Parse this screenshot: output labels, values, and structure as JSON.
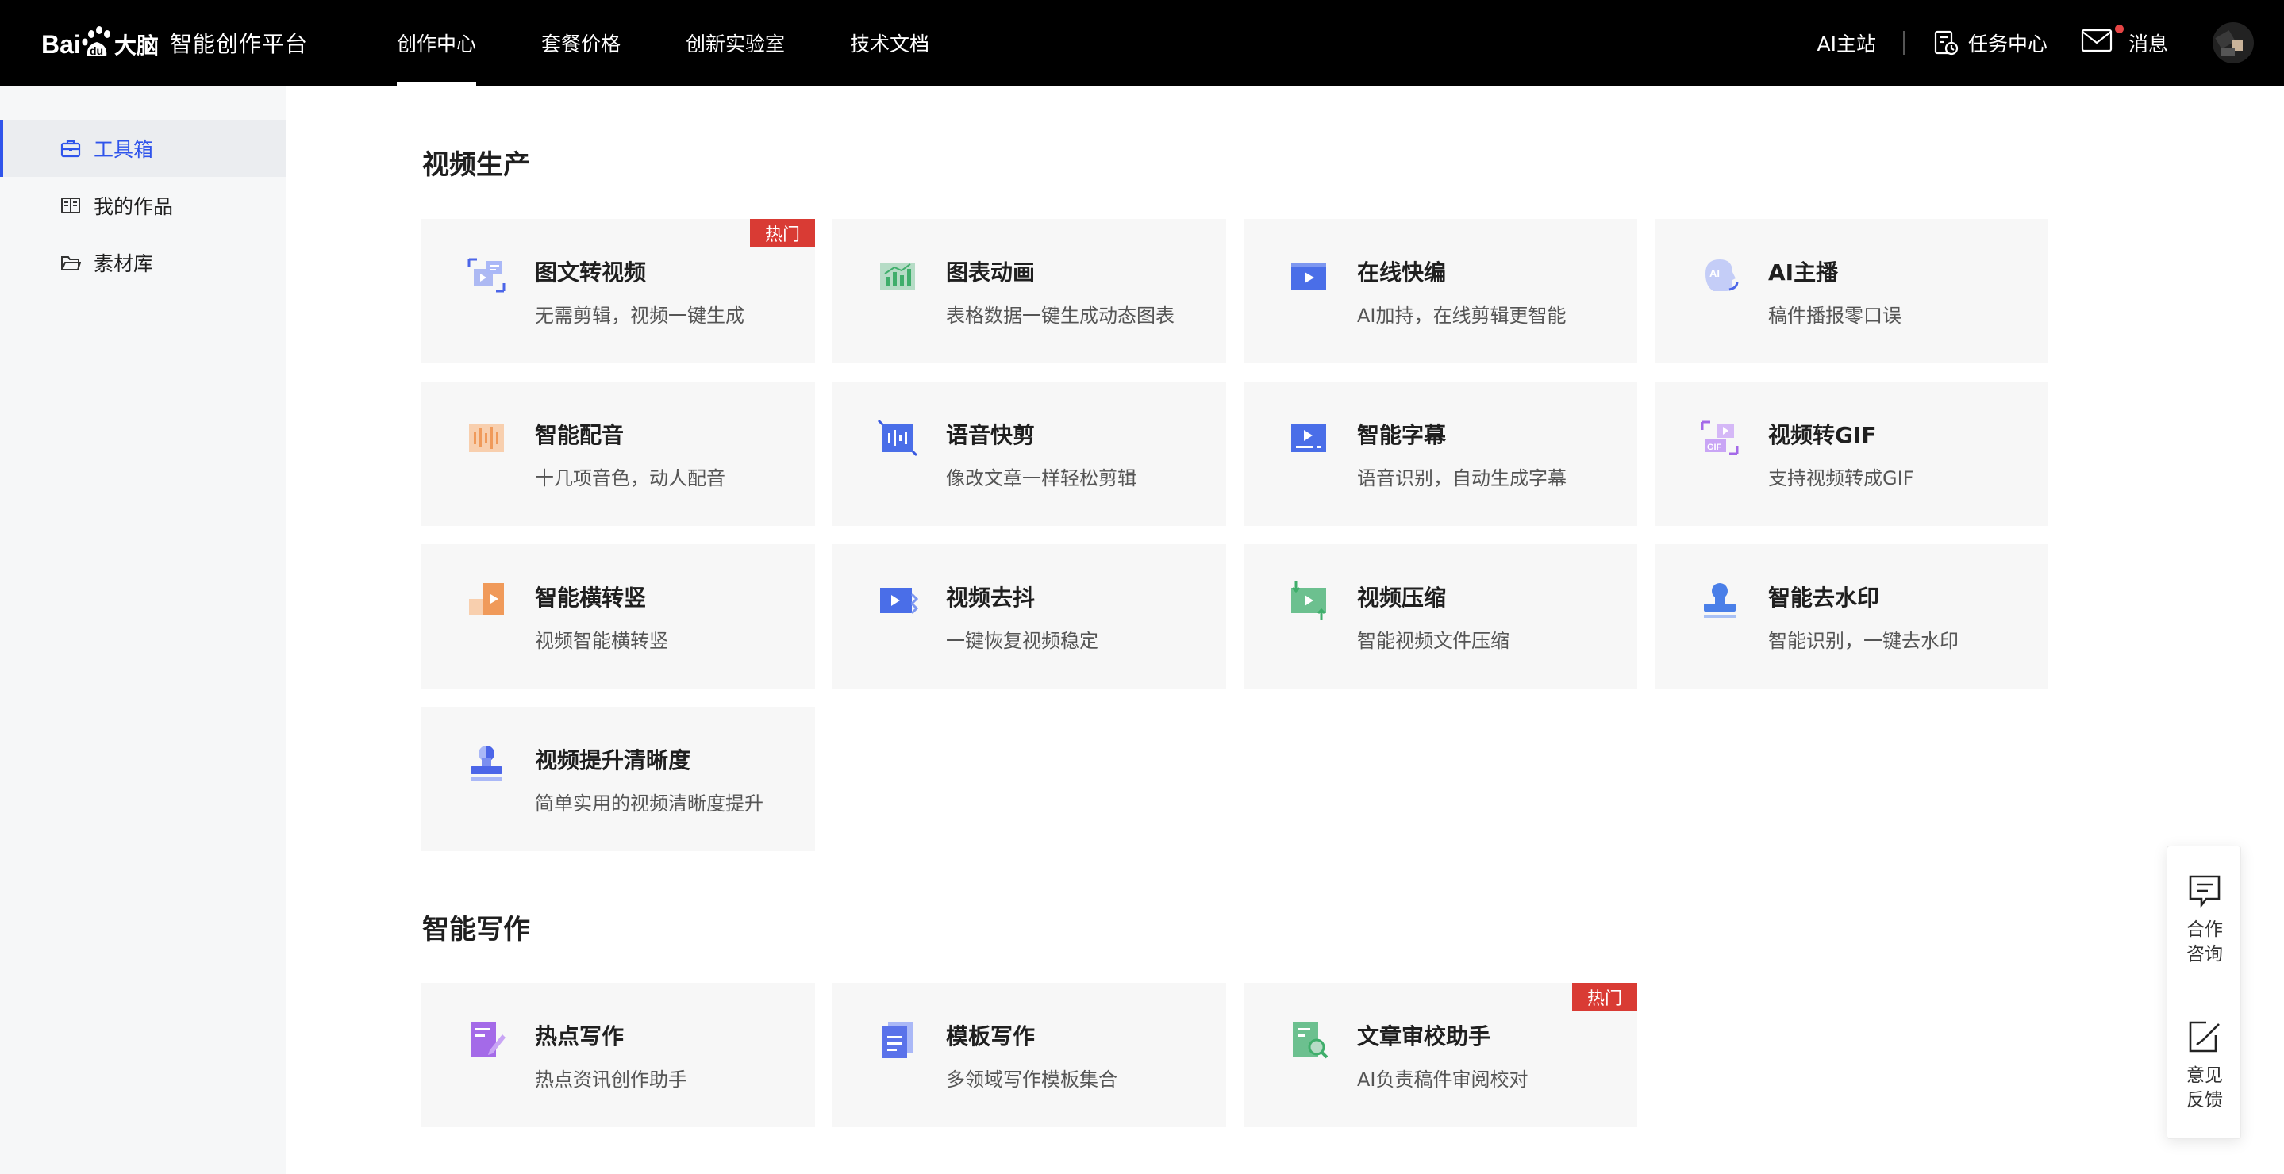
{
  "header": {
    "logo_text": "智能创作平台",
    "nav": [
      "创作中心",
      "套餐价格",
      "创新实验室",
      "技术文档"
    ],
    "active_nav": 0,
    "ai_site": "AI主站",
    "task_center": "任务中心",
    "messages": "消息"
  },
  "sidebar": {
    "items": [
      "工具箱",
      "我的作品",
      "素材库"
    ],
    "active": 0
  },
  "sections": [
    {
      "title": "视频生产",
      "cards": [
        {
          "title": "图文转视频",
          "desc": "无需剪辑，视频一键生成",
          "badge": "热门",
          "icon": "image-to-video-icon"
        },
        {
          "title": "图表动画",
          "desc": "表格数据一键生成动态图表",
          "icon": "chart-animation-icon"
        },
        {
          "title": "在线快编",
          "desc": "AI加持，在线剪辑更智能",
          "icon": "online-edit-icon"
        },
        {
          "title": "AI主播",
          "desc": "稿件播报零口误",
          "icon": "ai-anchor-icon"
        },
        {
          "title": "智能配音",
          "desc": "十几项音色，动人配音",
          "icon": "voiceover-icon"
        },
        {
          "title": "语音快剪",
          "desc": "像改文章一样轻松剪辑",
          "icon": "voice-cut-icon"
        },
        {
          "title": "智能字幕",
          "desc": "语音识别，自动生成字幕",
          "icon": "subtitle-icon"
        },
        {
          "title": "视频转GIF",
          "desc": "支持视频转成GIF",
          "icon": "video-to-gif-icon"
        },
        {
          "title": "智能横转竖",
          "desc": "视频智能横转竖",
          "icon": "landscape-to-portrait-icon"
        },
        {
          "title": "视频去抖",
          "desc": "一键恢复视频稳定",
          "icon": "stabilize-icon"
        },
        {
          "title": "视频压缩",
          "desc": "智能视频文件压缩",
          "icon": "compress-icon"
        },
        {
          "title": "智能去水印",
          "desc": "智能识别，一键去水印",
          "icon": "remove-watermark-icon"
        },
        {
          "title": "视频提升清晰度",
          "desc": "简单实用的视频清晰度提升",
          "icon": "enhance-clarity-icon"
        }
      ]
    },
    {
      "title": "智能写作",
      "cards": [
        {
          "title": "热点写作",
          "desc": "热点资讯创作助手",
          "icon": "hot-writing-icon"
        },
        {
          "title": "模板写作",
          "desc": "多领域写作模板集合",
          "icon": "template-writing-icon"
        },
        {
          "title": "文章审校助手",
          "desc": "AI负责稿件审阅校对",
          "badge": "热门",
          "icon": "proofread-icon"
        }
      ]
    }
  ],
  "float_panel": {
    "consult": "合作咨询",
    "feedback": "意见反馈"
  },
  "colors": {
    "accent": "#2f54eb",
    "badge": "#d93b34",
    "header_bg": "#000000"
  }
}
